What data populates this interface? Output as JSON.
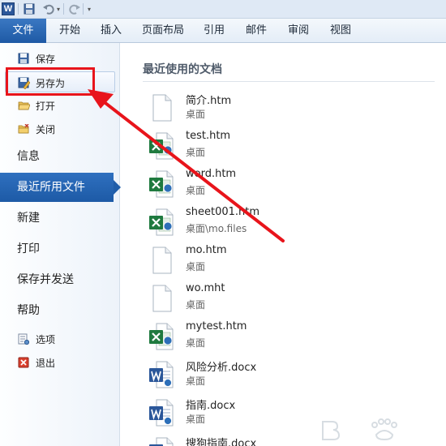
{
  "quick_access": {
    "app_logo": "W",
    "icons": [
      "save-icon",
      "undo-icon",
      "redo-icon"
    ]
  },
  "ribbon": {
    "tabs": [
      "文件",
      "开始",
      "插入",
      "页面布局",
      "引用",
      "邮件",
      "审阅",
      "视图"
    ],
    "active_tab": "文件",
    "accent_color": "#2563b0"
  },
  "backstage": {
    "small_items": [
      {
        "label": "保存",
        "icon": "save-icon"
      },
      {
        "label": "另存为",
        "icon": "save-as-icon"
      },
      {
        "label": "打开",
        "icon": "open-folder-icon"
      },
      {
        "label": "关闭",
        "icon": "close-folder-icon"
      }
    ],
    "big_items": [
      "信息",
      "最近所用文件",
      "新建",
      "打印",
      "保存并发送",
      "帮助"
    ],
    "selected_item": "最近所用文件",
    "bottom_items": [
      {
        "label": "选项",
        "icon": "options-icon"
      },
      {
        "label": "退出",
        "icon": "exit-icon"
      }
    ]
  },
  "recent": {
    "title": "最近使用的文档",
    "files": [
      {
        "name": "简介.htm",
        "path": "桌面",
        "icon": "blank-document-icon"
      },
      {
        "name": "test.htm",
        "path": "桌面",
        "icon": "excel-file-icon"
      },
      {
        "name": "word.htm",
        "path": "桌面",
        "icon": "excel-file-icon"
      },
      {
        "name": "sheet001.htm",
        "path": "桌面\\mo.files",
        "icon": "excel-file-icon"
      },
      {
        "name": "mo.htm",
        "path": "桌面",
        "icon": "blank-document-icon"
      },
      {
        "name": "wo.mht",
        "path": "桌面",
        "icon": "blank-document-icon"
      },
      {
        "name": "mytest.htm",
        "path": "桌面",
        "icon": "excel-file-icon"
      },
      {
        "name": "风险分析.docx",
        "path": "桌面",
        "icon": "word-file-icon"
      },
      {
        "name": "指南.docx",
        "path": "桌面",
        "icon": "word-file-icon"
      },
      {
        "name": "搜狗指南.docx",
        "path": "",
        "icon": "word-file-icon"
      }
    ]
  },
  "annotation": {
    "highlight_color": "#e8141b"
  }
}
